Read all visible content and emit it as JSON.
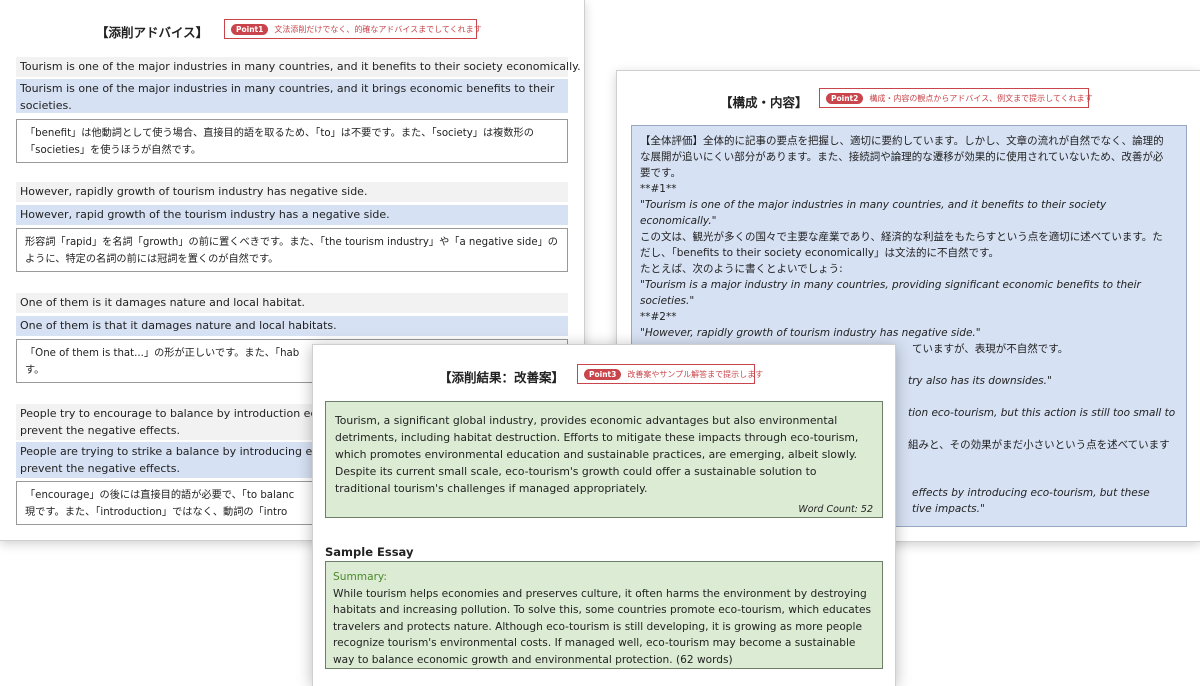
{
  "left_panel": {
    "title": "【添削アドバイス】",
    "point_badge": "Point1",
    "point_text": "文法添削だけでなく、的確なアドバイスまでしてくれます",
    "items": [
      {
        "original": "Tourism is one of the major industries in many countries, and it benefits to their society economically.",
        "corrected": "Tourism is one of the major industries in many countries, and it brings economic benefits to their societies.",
        "note": "「benefit」は他動詞として使う場合、直接目的語を取るため、「to」は不要です。また、「society」は複数形の「societies」を使うほうが自然です。"
      },
      {
        "original": "However, rapidly growth of tourism industry has negative side.",
        "corrected": "However, rapid growth of the tourism industry has a negative side.",
        "note": "形容詞「rapid」を名詞「growth」の前に置くべきです。また、「the tourism industry」や「a negative side」のように、特定の名詞の前には冠詞を置くのが自然です。"
      },
      {
        "original": "One of them is it damages nature and local habitat.",
        "corrected": "One of them is that it damages nature and local habitats.",
        "note": "「One of them is that...」の形が正しいです。また、「hab\nす。"
      },
      {
        "original": "People try to encourage to balance by introduction eco\nprevent the negative effects.",
        "corrected": "People are trying to strike a balance by introducing ec\nprevent the negative effects.",
        "note": "「encourage」の後には直接目的語が必要で、「to balanc\n現です。また、「introduction」ではなく、動詞の「intro"
      }
    ]
  },
  "right_panel": {
    "title": "【構成・内容】",
    "point_badge": "Point2",
    "point_text": "構成・内容の観点からアドバイス、例文まで提示してくれます",
    "lines": [
      "【全体評価】全体的に記事の要点を把握し、適切に要約しています。しかし、文章の流れが自然でなく、論理的",
      "な展開が追いにくい部分があります。また、接続詞や論理的な遷移が効果的に使用されていないため、改善が必",
      "要です。",
      "**#1**",
      "\"Tourism is one of the major industries in many countries, and it benefits to their society",
      "economically.\"",
      "この文は、観光が多くの国々で主要な産業であり、経済的な利益をもたらすという点を適切に述べています。た",
      "だし、「benefits to their society economically」は文法的に不自然です。",
      "たとえば、次のように書くとよいでしょう:",
      "\"Tourism is a major industry in many countries, providing significant economic benefits to their",
      "societies.\"",
      "**#2**",
      "\"However, rapidly growth of tourism industry has negative side.\"",
      "ていますが、表現が不自然です。",
      "",
      "try also has its downsides.\"",
      "",
      "tion eco-tourism, but this action is still too small to",
      "",
      "組みと、その効果がまだ小さいという点を述べています",
      "",
      "",
      "effects by introducing eco-tourism, but these",
      "tive impacts.\""
    ]
  },
  "front_panel": {
    "title": "【添削結果：改善案】",
    "point_badge": "Point3",
    "point_text": "改善案やサンプル解答まで提示します",
    "improved_text": "Tourism, a significant global industry, provides economic advantages but also environmental detriments, including habitat destruction. Efforts to mitigate these impacts through eco-tourism, which promotes environmental education and sustainable practices, are emerging, albeit slowly. Despite its current small scale, eco-tourism's growth could offer a sustainable solution to traditional tourism's challenges if managed appropriately.",
    "word_count": "Word Count: 52",
    "sample_title": "Sample Essay",
    "summary_label": "Summary:",
    "sample_text": "While tourism helps economies and preserves culture, it often harms the environment by destroying habitats and increasing pollution. To solve this, some countries promote eco-tourism, which educates travelers and protects nature. Although eco-tourism is still developing, it is growing as more people recognize tourism's environmental costs. If managed well, eco-tourism may become a sustainable way to balance economic growth and environmental protection. (62 words)"
  }
}
